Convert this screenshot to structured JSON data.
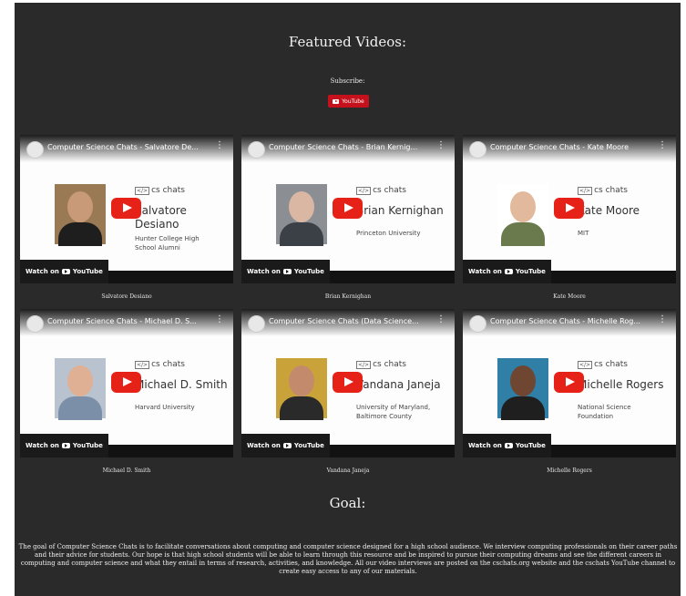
{
  "section": {
    "title": "Featured Videos:",
    "subscribe_label": "Subscribe:",
    "youtube_button": "YouTube"
  },
  "videos": [
    {
      "title": "Computer Science Chats - Salvatore De...",
      "logo": "cs chats",
      "logo_code": "</>",
      "name_line1": "Salvatore",
      "name_line2": "Desiano",
      "aff_line1": "Hunter College High",
      "aff_line2": "School Alumni",
      "watch_on": "Watch on",
      "yt_label": "YouTube",
      "caption": "Salvatore Desiano",
      "photo_bg": "#9a7a55",
      "face": "#c99a78",
      "shirt": "#1e1e1e"
    },
    {
      "title": "Computer Science Chats - Brian Kernig...",
      "logo": "cs chats",
      "logo_code": "</>",
      "name_line1": "Brian Kernighan",
      "name_line2": "",
      "aff_line1": "Princeton University",
      "aff_line2": "",
      "watch_on": "Watch on",
      "yt_label": "YouTube",
      "caption": "Brian Kernighan",
      "photo_bg": "#8b8f94",
      "face": "#d9b7a3",
      "shirt": "#3b3f46"
    },
    {
      "title": "Computer Science Chats - Kate Moore",
      "logo": "cs chats",
      "logo_code": "</>",
      "name_line1": "Kate Moore",
      "name_line2": "",
      "aff_line1": "MIT",
      "aff_line2": "",
      "watch_on": "Watch on",
      "yt_label": "YouTube",
      "caption": "Kate Moore",
      "photo_bg": "#ffffff",
      "face": "#e2b99c",
      "shirt": "#6b7a4c"
    },
    {
      "title": "Computer Science Chats - Michael D. S...",
      "logo": "cs chats",
      "logo_code": "</>",
      "name_line1": "Michael D. Smith",
      "name_line2": "",
      "aff_line1": "Harvard University",
      "aff_line2": "",
      "watch_on": "Watch on",
      "yt_label": "YouTube",
      "caption": "Michael D. Smith",
      "photo_bg": "#b9c3cf",
      "face": "#e0b094",
      "shirt": "#7c8fa8"
    },
    {
      "title": "Computer Science Chats (Data Science...",
      "logo": "cs chats",
      "logo_code": "</>",
      "name_line1": "Vandana Janeja",
      "name_line2": "",
      "aff_line1": "University of Maryland,",
      "aff_line2": "Baltimore County",
      "watch_on": "Watch on",
      "yt_label": "YouTube",
      "caption": "Vandana Janeja",
      "photo_bg": "#c9a33a",
      "face": "#c38b6c",
      "shirt": "#2a2a2a"
    },
    {
      "title": "Computer Science Chats - Michelle Rog...",
      "logo": "cs chats",
      "logo_code": "</>",
      "name_line1": "Michelle Rogers",
      "name_line2": "",
      "aff_line1": "National Science",
      "aff_line2": "Foundation",
      "watch_on": "Watch on",
      "yt_label": "YouTube",
      "caption": "Michelle Rogers",
      "photo_bg": "#2f7fa6",
      "face": "#6e4632",
      "shirt": "#1f1f1f"
    }
  ],
  "goal": {
    "title": "Goal:",
    "text": "The goal of Computer Science Chats is to facilitate conversations about computing and computer science designed for a high school audience. We interview computing professionals on their career paths and their advice for students. Our hope is that high school students will be able to learn through this resource and be inspired to pursue their computing dreams and see the different careers in computing and computer science and what they entail in terms of research, activities, and knowledge. All our video interviews are posted on the cschats.org website and the cschats YouTube channel to create easy access to any of our materials."
  },
  "colors": {
    "panel_bg": "#2a2a2a",
    "youtube_red": "#e62117",
    "subscribe_red": "#c4111b"
  }
}
